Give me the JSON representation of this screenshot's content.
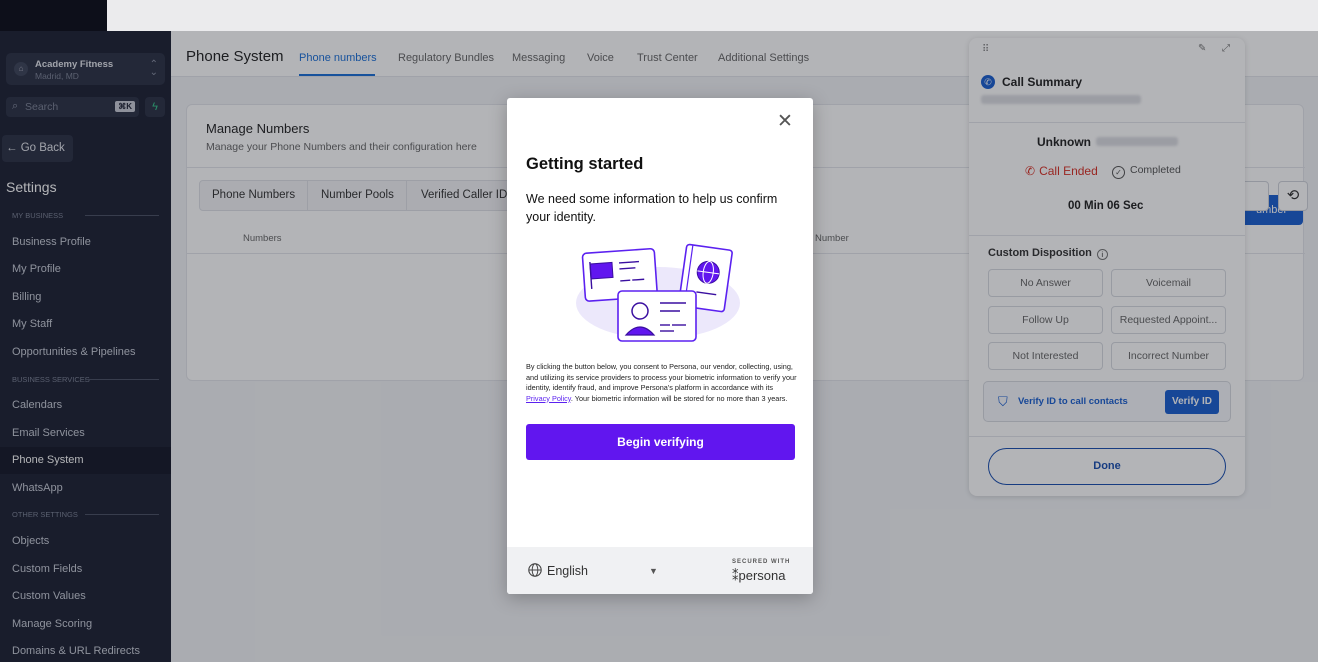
{
  "account": {
    "name": "Academy Fitness",
    "location": "Madrid, MD"
  },
  "search": {
    "placeholder": "Search",
    "shortcut": "⌘K"
  },
  "sidebar": {
    "go_back": "Go Back",
    "heading": "Settings",
    "sections": {
      "my_business": "MY BUSINESS",
      "business_services": "BUSINESS SERVICES",
      "other_settings": "OTHER SETTINGS"
    },
    "items": [
      "Business Profile",
      "My Profile",
      "Billing",
      "My Staff",
      "Opportunities & Pipelines",
      "Calendars",
      "Email Services",
      "Phone System",
      "WhatsApp",
      "Objects",
      "Custom Fields",
      "Custom Values",
      "Manage Scoring",
      "Domains & URL Redirects"
    ],
    "active_item": "Phone System"
  },
  "header": {
    "title": "Phone System",
    "tabs": [
      "Phone numbers",
      "Regulatory Bundles",
      "Messaging",
      "Voice",
      "Trust Center",
      "Additional Settings"
    ],
    "active_tab": "Phone numbers"
  },
  "manage": {
    "title": "Manage Numbers",
    "subtitle": "Manage your Phone Numbers and their configuration here",
    "subtabs": [
      "Phone Numbers",
      "Number Pools",
      "Verified Caller ID"
    ],
    "columns": [
      "Numbers",
      "Number"
    ],
    "add_button": "umber"
  },
  "call_summary": {
    "title": "Call Summary",
    "contact": "Unknown",
    "status": "Call Ended",
    "result": "Completed",
    "duration": "00 Min 06 Sec",
    "disposition_label": "Custom Disposition",
    "dispositions": [
      "No Answer",
      "Voicemail",
      "Follow Up",
      "Requested Appoint...",
      "Not Interested",
      "Incorrect Number"
    ],
    "verify_text": "Verify ID to call contacts",
    "verify_button": "Verify ID",
    "done_button": "Done"
  },
  "modal": {
    "title": "Getting started",
    "intro": "We need some information to help us confirm your identity.",
    "consent_before": "By clicking the button below, you consent to Persona, our vendor, collecting, using, and utilizing its service providers to process your biometric information to verify your identity, identify fraud, and improve Persona's platform in accordance with its ",
    "consent_link": "Privacy Policy",
    "consent_after": ". Your biometric information will be stored for no more than 3 years.",
    "button": "Begin verifying",
    "language": "English",
    "secured_with": "SECURED WITH",
    "brand": "persona",
    "accent": "#6116ef"
  },
  "colors": {
    "sidebar_bg": "#1c2133",
    "primary": "#1a5fd0",
    "danger": "#d93025"
  }
}
